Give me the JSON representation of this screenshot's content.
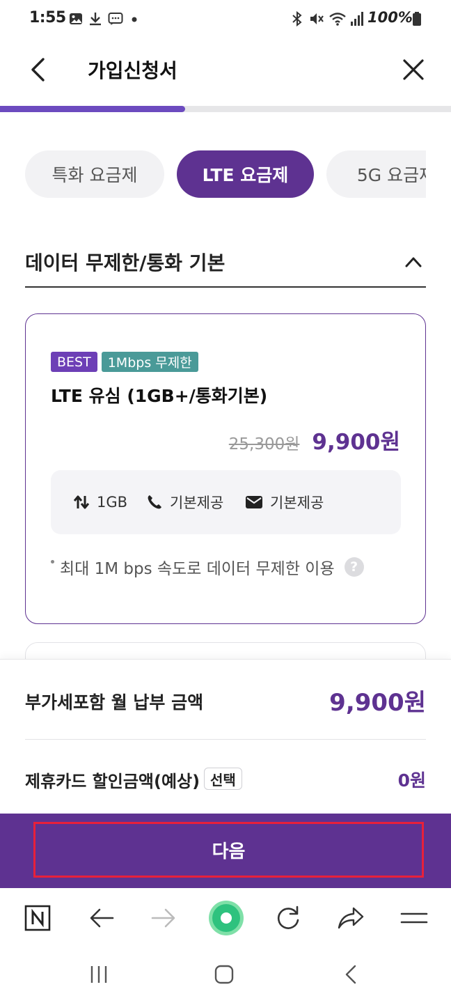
{
  "status_bar": {
    "time": "1:55",
    "battery": "100%",
    "left_icons": [
      "image-icon",
      "download-icon",
      "message-icon",
      "dot-icon"
    ],
    "right_icons": [
      "bluetooth-icon",
      "mute-icon",
      "wifi-icon",
      "signal-icon",
      "battery-icon"
    ]
  },
  "header": {
    "title": "가입신청서",
    "back_icon": "chevron-left-icon",
    "close_icon": "close-icon"
  },
  "progress": {
    "value": 0.41
  },
  "tabs": [
    {
      "label": "특화 요금제",
      "active": false
    },
    {
      "label": "LTE 요금제",
      "active": true
    },
    {
      "label": "5G 요금제",
      "active": false
    }
  ],
  "section": {
    "title": "데이터 무제한/통화 기본",
    "expanded": true
  },
  "plan": {
    "badges": [
      "BEST",
      "1Mbps 무제한"
    ],
    "name": "LTE 유심 (1GB+/통화기본)",
    "original_price": "25,300원",
    "sale_price": "9,900원",
    "features": [
      {
        "icon": "data-arrows-icon",
        "label": "1GB"
      },
      {
        "icon": "phone-icon",
        "label": "기본제공"
      },
      {
        "icon": "message-icon",
        "label": "기본제공"
      }
    ],
    "note": "최대 1M bps 속도로 데이터 무제한 이용",
    "help_glyph": "?"
  },
  "summary": {
    "monthly_label": "부가세포함 월 납부 금액",
    "monthly_amount": "9,900원",
    "card_discount_label": "제휴카드 할인금액(예상)",
    "select_label": "선택",
    "card_discount_amount": "0원"
  },
  "next_button": {
    "label": "다음"
  },
  "browser_toolbar": {
    "items": [
      "naver-home-icon",
      "back-arrow-icon",
      "forward-arrow-icon",
      "green-dot-icon",
      "refresh-icon",
      "share-icon",
      "menu-icon"
    ]
  },
  "android_nav": {
    "items": [
      "recent-apps-icon",
      "home-icon",
      "back-icon"
    ]
  },
  "colors": {
    "brand_purple": "#5e3291",
    "progress_fill": "#6c4bbf",
    "badge_best": "#6d3fb6",
    "badge_speed": "#4a9a98",
    "highlight_red": "#e8203a"
  }
}
